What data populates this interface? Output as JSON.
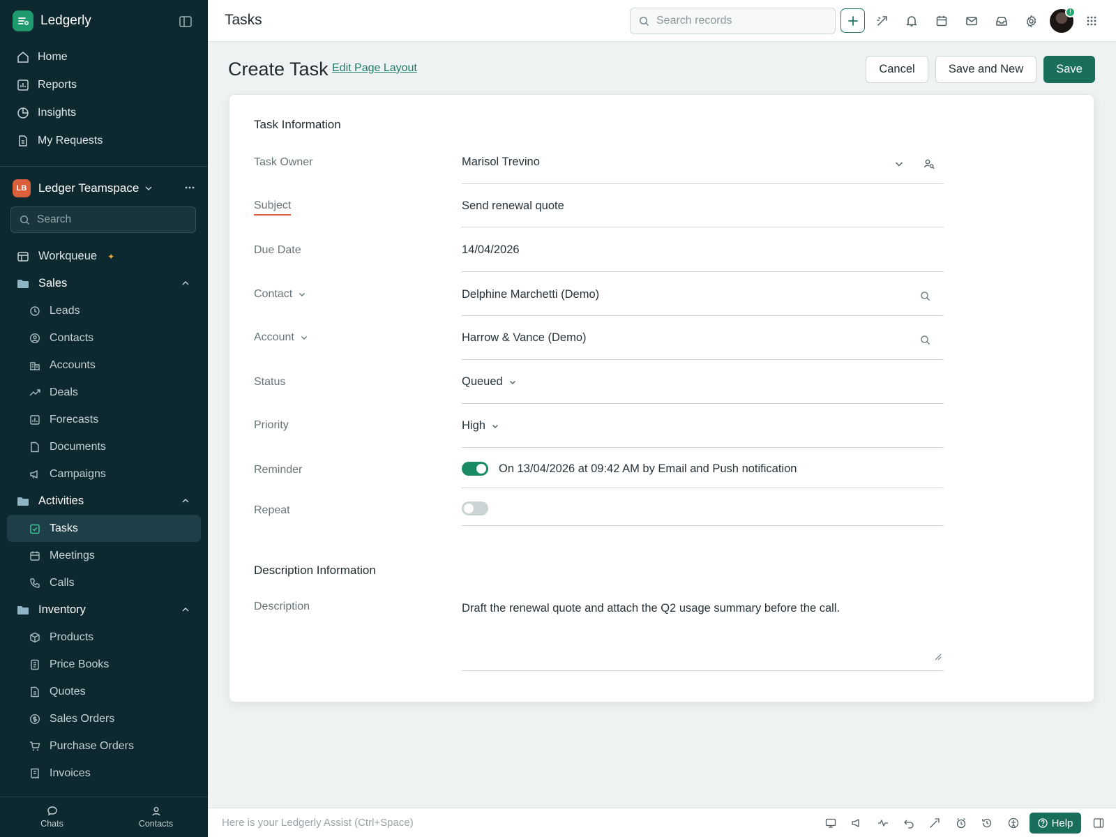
{
  "app": {
    "name": "Ledgerly"
  },
  "sidebar": {
    "nav": [
      {
        "label": "Home",
        "icon": "home-icon"
      },
      {
        "label": "Reports",
        "icon": "reports-icon"
      },
      {
        "label": "Insights",
        "icon": "insights-icon"
      },
      {
        "label": "My Requests",
        "icon": "requests-icon"
      }
    ],
    "team": {
      "badge": "LB",
      "name": "Ledger Teamspace"
    },
    "search_placeholder": "Search",
    "workqueue": "Workqueue",
    "sections": {
      "sales": {
        "label": "Sales",
        "items": [
          "Leads",
          "Contacts",
          "Accounts",
          "Deals",
          "Forecasts",
          "Documents",
          "Campaigns"
        ]
      },
      "activities": {
        "label": "Activities",
        "items": [
          "Tasks",
          "Meetings",
          "Calls"
        ]
      },
      "inventory": {
        "label": "Inventory",
        "items": [
          "Products",
          "Price Books",
          "Quotes",
          "Sales Orders",
          "Purchase Orders",
          "Invoices"
        ]
      }
    },
    "active_item": "Tasks",
    "bottom": [
      {
        "label": "Chats"
      },
      {
        "label": "Contacts"
      }
    ]
  },
  "header": {
    "title": "Tasks",
    "search_placeholder": "Search records",
    "avatar_badge": "!"
  },
  "page": {
    "title": "Create Task",
    "edit_layout": "Edit Page Layout",
    "buttons": {
      "cancel": "Cancel",
      "save_new": "Save and New",
      "save": "Save"
    }
  },
  "form": {
    "task_section": "Task Information",
    "fields": {
      "owner": {
        "label": "Task Owner",
        "value": "Marisol Trevino"
      },
      "subject": {
        "label": "Subject",
        "value": "Send renewal quote"
      },
      "due": {
        "label": "Due Date",
        "value": "14/04/2026"
      },
      "contact": {
        "label": "Contact",
        "value": "Delphine Marchetti (Demo)"
      },
      "account": {
        "label": "Account",
        "value": "Harrow & Vance (Demo)"
      },
      "status": {
        "label": "Status",
        "value": "Queued"
      },
      "priority": {
        "label": "Priority",
        "value": "High"
      },
      "reminder": {
        "label": "Reminder",
        "enabled": true,
        "text": "On 13/04/2026 at 09:42 AM by Email and Push notification"
      },
      "repeat": {
        "label": "Repeat",
        "enabled": false
      }
    },
    "desc_section": "Description Information",
    "description": {
      "label": "Description",
      "value": "Draft the renewal quote and attach the Q2 usage summary before the call."
    }
  },
  "bottombar": {
    "assist": "Here is your Ledgerly Assist (Ctrl+Space)",
    "help": "Help"
  },
  "colors": {
    "sidebar": "#0e2830",
    "accent": "#1a6e5c",
    "required": "#d9603b"
  }
}
